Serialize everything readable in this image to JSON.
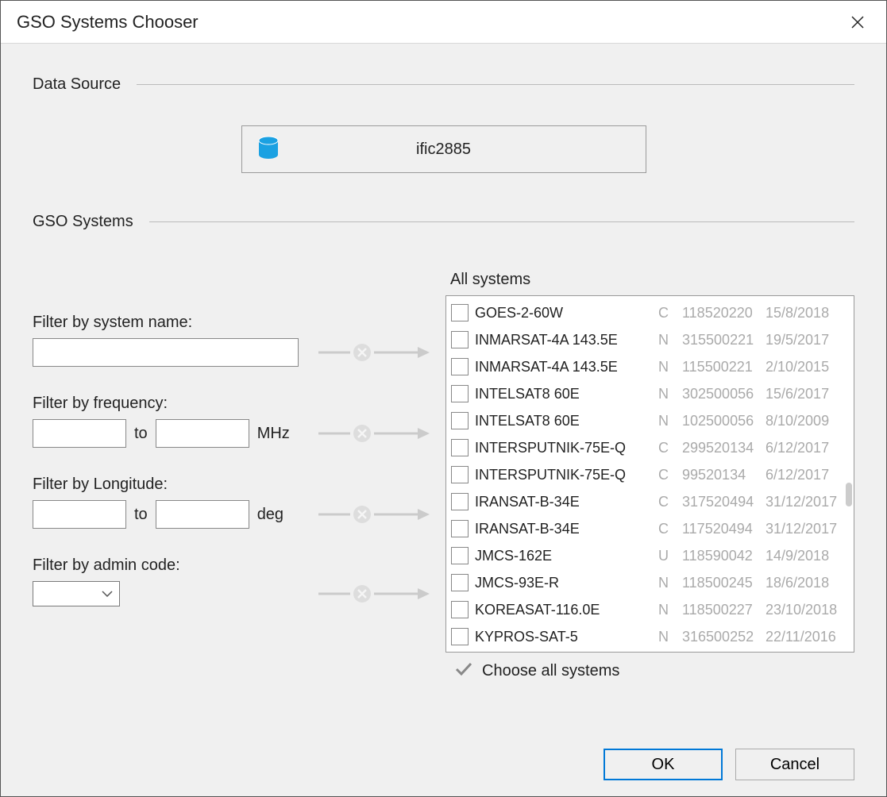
{
  "dialog": {
    "title": "GSO Systems Chooser"
  },
  "sections": {
    "data_source_label": "Data Source",
    "gso_systems_label": "GSO Systems"
  },
  "data_source": {
    "name": "ific2885"
  },
  "filters": {
    "system_name": {
      "label": "Filter by system name:",
      "value": ""
    },
    "frequency": {
      "label": "Filter by frequency:",
      "from": "",
      "to": "",
      "to_label": "to",
      "unit": "MHz"
    },
    "longitude": {
      "label": "Filter by Longitude:",
      "from": "",
      "to": "",
      "to_label": "to",
      "unit": "deg"
    },
    "admin_code": {
      "label": "Filter by admin code:",
      "value": ""
    }
  },
  "systems": {
    "heading": "All systems",
    "choose_all_label": "Choose all systems",
    "rows": [
      {
        "name": "GOES-2-60W",
        "type": "C",
        "id": "118520220",
        "date": "15/8/2018"
      },
      {
        "name": "INMARSAT-4A 143.5E",
        "type": "N",
        "id": "315500221",
        "date": "19/5/2017"
      },
      {
        "name": "INMARSAT-4A 143.5E",
        "type": "N",
        "id": "115500221",
        "date": "2/10/2015"
      },
      {
        "name": "INTELSAT8 60E",
        "type": "N",
        "id": "302500056",
        "date": "15/6/2017"
      },
      {
        "name": "INTELSAT8 60E",
        "type": "N",
        "id": "102500056",
        "date": "8/10/2009"
      },
      {
        "name": "INTERSPUTNIK-75E-Q",
        "type": "C",
        "id": "299520134",
        "date": "6/12/2017"
      },
      {
        "name": "INTERSPUTNIK-75E-Q",
        "type": "C",
        "id": "99520134",
        "date": "6/12/2017"
      },
      {
        "name": "IRANSAT-B-34E",
        "type": "C",
        "id": "317520494",
        "date": "31/12/2017"
      },
      {
        "name": "IRANSAT-B-34E",
        "type": "C",
        "id": "117520494",
        "date": "31/12/2017"
      },
      {
        "name": "JMCS-162E",
        "type": "U",
        "id": "118590042",
        "date": "14/9/2018"
      },
      {
        "name": "JMCS-93E-R",
        "type": "N",
        "id": "118500245",
        "date": "18/6/2018"
      },
      {
        "name": "KOREASAT-116.0E",
        "type": "N",
        "id": "118500227",
        "date": "23/10/2018"
      },
      {
        "name": "KYPROS-SAT-5",
        "type": "N",
        "id": "316500252",
        "date": "22/11/2016"
      }
    ]
  },
  "buttons": {
    "ok": "OK",
    "cancel": "Cancel"
  }
}
